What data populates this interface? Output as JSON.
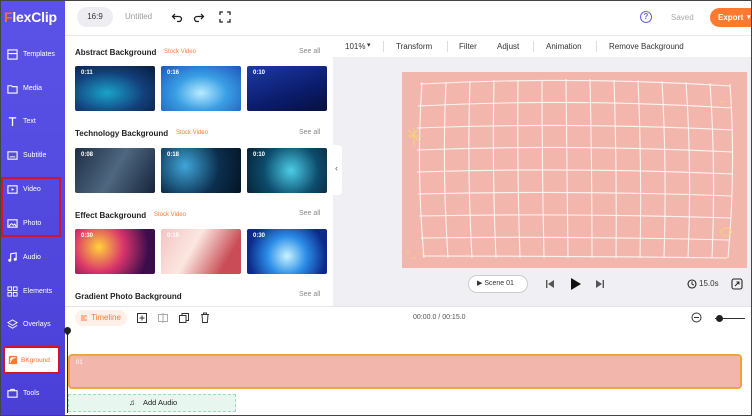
{
  "brand": {
    "name_first": "F",
    "name_rest": "lexClip"
  },
  "topbar": {
    "ratio": "16:9",
    "title": "Untitled",
    "help": "?",
    "saved": "Saved",
    "export": "Export"
  },
  "sidebar": {
    "items": [
      {
        "label": "Templates",
        "icon": "templates-icon"
      },
      {
        "label": "Media",
        "icon": "media-icon"
      },
      {
        "label": "Text",
        "icon": "text-icon"
      },
      {
        "label": "Subtitle",
        "icon": "subtitle-icon"
      },
      {
        "label": "Video",
        "icon": "video-icon"
      },
      {
        "label": "Photo",
        "icon": "photo-icon"
      },
      {
        "label": "Audio",
        "icon": "audio-icon"
      },
      {
        "label": "Elements",
        "icon": "elements-icon"
      },
      {
        "label": "Overlays",
        "icon": "overlays-icon"
      },
      {
        "label": "BKground",
        "icon": "background-icon"
      },
      {
        "label": "Tools",
        "icon": "tools-icon"
      }
    ],
    "active": "BKground"
  },
  "library": {
    "see_all": "See all",
    "sections": [
      {
        "title": "Abstract Background",
        "tag": "Stock Video",
        "thumbs": [
          "0:11",
          "0:16",
          "0:10"
        ]
      },
      {
        "title": "Technology Background",
        "tag": "Stock Video",
        "thumbs": [
          "0:08",
          "0:18",
          "0:10"
        ]
      },
      {
        "title": "Effect Background",
        "tag": "Stock Video",
        "thumbs": [
          "0:30",
          "0:15",
          "0:30"
        ]
      },
      {
        "title": "Gradient Photo Background",
        "tag": "",
        "thumbs": []
      }
    ]
  },
  "editor_toolbar": {
    "zoom": "101%",
    "transform": "Transform",
    "filter": "Filter",
    "adjust": "Adjust",
    "animation": "Animation",
    "remove_bg": "Remove Background"
  },
  "player": {
    "scene": "Scene 01",
    "duration": "15.0s"
  },
  "timeline": {
    "label": "Timeline",
    "time": "00:00.0 / 00:15.0",
    "clip_number": "01",
    "add_audio": "Add Audio"
  },
  "colors": {
    "sidebar": "#5b53e8",
    "accent": "#ff7a2f",
    "canvas": "#f3b6ad",
    "highlight": "#d2152b"
  }
}
